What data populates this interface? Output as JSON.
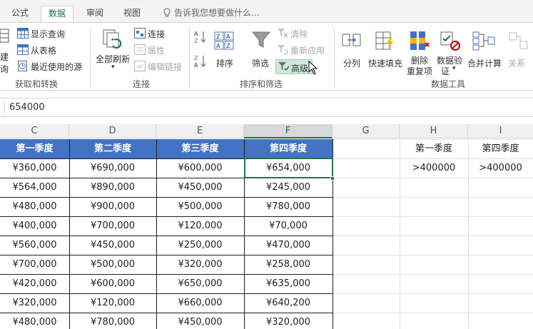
{
  "tabs": [
    "公式",
    "数据",
    "审阅",
    "视图"
  ],
  "active_tab": "数据",
  "tell_me": "告诉我您想要做什么...",
  "groups": {
    "get_transform": {
      "label": "获取和转换",
      "new_query": [
        "建",
        "询"
      ],
      "show_queries": "显示查询",
      "from_table": "从表格",
      "recent_sources": "最近使用的源"
    },
    "connections": {
      "label": "连接",
      "refresh_all": "全部刷新",
      "connections": "连接",
      "properties": "属性",
      "edit_links": "编辑链接"
    },
    "sort_filter": {
      "label": "排序和筛选",
      "sort": "排序",
      "filter": "筛选",
      "clear": "清除",
      "reapply": "重新应用",
      "advanced": "高级"
    },
    "data_tools": {
      "label": "数据工具",
      "text_to_columns": "分列",
      "flash_fill": "快速填充",
      "remove_dupes": [
        "删除",
        "重复项"
      ],
      "validation": [
        "数据验",
        "证"
      ],
      "consolidate": "合并计算",
      "relationships": "关系"
    }
  },
  "formula_value": "654000",
  "columns": [
    "C",
    "D",
    "E",
    "F",
    "G",
    "H",
    "I"
  ],
  "selected_column": "F",
  "table": {
    "headers": [
      "第一季度",
      "第二季度",
      "第三季度",
      "第四季度"
    ],
    "rows": [
      [
        "¥360,000",
        "¥690,000",
        "¥600,000",
        "¥654,000"
      ],
      [
        "¥564,000",
        "¥890,000",
        "¥450,000",
        "¥245,000"
      ],
      [
        "¥480,000",
        "¥900,000",
        "¥500,000",
        "¥780,000"
      ],
      [
        "¥400,000",
        "¥700,000",
        "¥120,000",
        "¥70,000"
      ],
      [
        "¥560,000",
        "¥450,000",
        "¥250,000",
        "¥470,000"
      ],
      [
        "¥700,000",
        "¥500,000",
        "¥320,000",
        "¥258,000"
      ],
      [
        "¥420,000",
        "¥600,000",
        "¥650,000",
        "¥635,000"
      ],
      [
        "¥320,000",
        "¥120,000",
        "¥660,000",
        "¥640,200"
      ],
      [
        "¥480,000",
        "¥780,000",
        "¥450,000",
        "¥320,000"
      ]
    ]
  },
  "criteria": {
    "headers": [
      "第一季度",
      "第四季度"
    ],
    "values": [
      ">400000",
      ">400000"
    ]
  },
  "colors": {
    "accent": "#217346",
    "table_header": "#4472c4"
  }
}
